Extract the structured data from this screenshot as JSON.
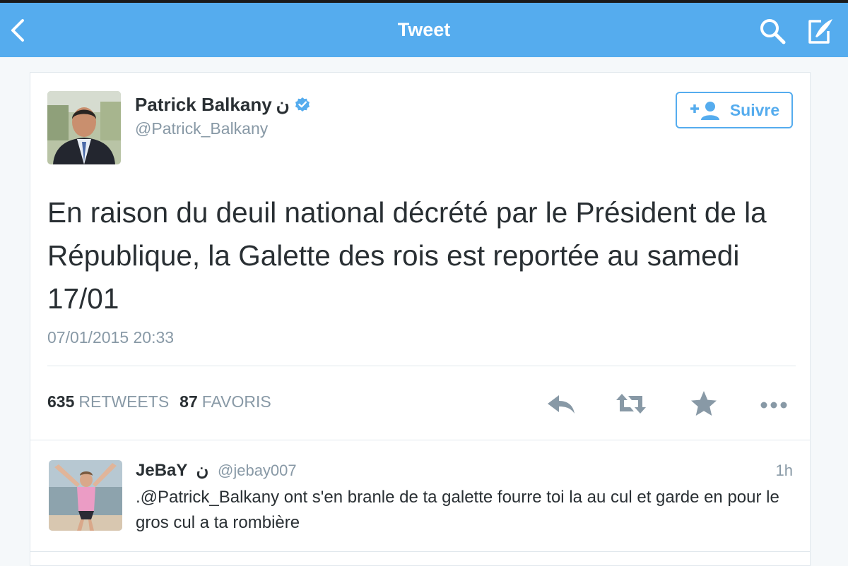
{
  "navbar": {
    "title": "Tweet",
    "back_icon": "chevron-left-icon",
    "search_icon": "search-icon",
    "compose_icon": "compose-tweet-icon",
    "color": "#55acee"
  },
  "tweet": {
    "author": {
      "display_name": "Patrick Balkany",
      "name_glyph": "ن",
      "handle": "@Patrick_Balkany",
      "verified": true
    },
    "follow_label": "Suivre",
    "text": "En raison du deuil national décrété par le Président de la République, la Galette des rois est reportée au samedi 17/01",
    "timestamp": "07/01/2015 20:33",
    "stats": {
      "retweets_count": "635",
      "retweets_label": "RETWEETS",
      "favorites_count": "87",
      "favorites_label": "FAVORIS"
    },
    "actions": [
      "reply-icon",
      "retweet-icon",
      "favorite-star-icon",
      "more-dots-icon"
    ]
  },
  "reply": {
    "display_name": "JeBaY",
    "name_glyph": "ن",
    "handle": "@jebay007",
    "time": "1h",
    "text": ".@Patrick_Balkany ont s'en branle de ta galette fourre toi la au cul et garde en pour le gros cul a ta rombière"
  },
  "colors": {
    "accent": "#55acee",
    "text": "#292f33",
    "muted": "#8899a6",
    "divider": "#e1e8ed"
  }
}
